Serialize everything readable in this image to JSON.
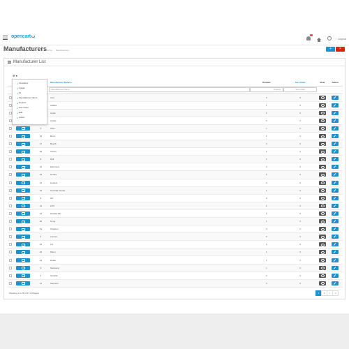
{
  "header": {
    "logo_text": "opencart",
    "logout_label": "Logout"
  },
  "page": {
    "title": "Manufacturers",
    "breadcrumb": [
      "Home",
      "Manufacturers"
    ],
    "add_label": "+",
    "delete_label": "×"
  },
  "panel": {
    "title": "Manufacturer List",
    "column_button": "⚙ ▾"
  },
  "columns_menu": [
    "Checkbox",
    "Image",
    "ID",
    "Manufacturer Name",
    "Product",
    "Sort Order",
    "Edit",
    "Action"
  ],
  "table": {
    "headers": {
      "name": "Manufacturer Name ▴",
      "product": "Product",
      "sort_order": "Sort Order",
      "view": "View",
      "action": "Action"
    },
    "filters": {
      "name_placeholder": "Manufacturer Name",
      "product_placeholder": "Product",
      "sort_placeholder": "Sort Order"
    },
    "rows": [
      {
        "id": "",
        "name": "Acer",
        "product": "0",
        "sort": "0"
      },
      {
        "id": "",
        "name": "Adidas",
        "product": "1",
        "sort": "0"
      },
      {
        "id": "",
        "name": "Apple",
        "product": "1",
        "sort": "0"
      },
      {
        "id": "",
        "name": "Arielle",
        "product": "0",
        "sort": "0"
      },
      {
        "id": "6",
        "name": "Asus",
        "product": "1",
        "sort": "0"
      },
      {
        "id": "15",
        "name": "Benz",
        "product": "1",
        "sort": "0"
      },
      {
        "id": "17",
        "name": "Bosch",
        "product": "0",
        "sort": "0"
      },
      {
        "id": "18",
        "name": "Canon",
        "product": "1",
        "sort": "0"
      },
      {
        "id": "8",
        "name": "Dell",
        "product": "1",
        "sort": "0"
      },
      {
        "id": "10",
        "name": "Electrolux",
        "product": "0",
        "sort": "0"
      },
      {
        "id": "19",
        "name": "Honda",
        "product": "1",
        "sort": "0"
      },
      {
        "id": "14",
        "name": "Huawei",
        "product": "0",
        "sort": "0"
      },
      {
        "id": "16",
        "name": "Hyundai Vendor",
        "product": "1",
        "sort": "0"
      },
      {
        "id": "5",
        "name": "HP",
        "product": "0",
        "sort": "0"
      },
      {
        "id": "13",
        "name": "HTC",
        "product": "1",
        "sort": "0"
      },
      {
        "id": "12",
        "name": "Hewlett Pkr",
        "product": "1",
        "sort": "0"
      },
      {
        "id": "20",
        "name": "Kong",
        "product": "1",
        "sort": "0"
      },
      {
        "id": "19",
        "name": "Kingston",
        "product": "0",
        "sort": "0"
      },
      {
        "id": "3",
        "name": "Lenovo",
        "product": "0",
        "sort": "0"
      },
      {
        "id": "21",
        "name": "LG",
        "product": "1",
        "sort": "0"
      },
      {
        "id": "22",
        "name": "Nikon",
        "product": "1",
        "sort": "0"
      },
      {
        "id": "24",
        "name": "Nokia",
        "product": "1",
        "sort": "0"
      },
      {
        "id": "9",
        "name": "Samsung",
        "product": "1",
        "sort": "0"
      },
      {
        "id": "4",
        "name": "Sandisk",
        "product": "0",
        "sort": "0"
      },
      {
        "id": "11",
        "name": "Siemens",
        "product": "0",
        "sort": "0"
      }
    ]
  },
  "footer": {
    "showing": "Showing 1 to 25 of 27 (2 Pages)",
    "pages": [
      "1",
      "2",
      ">",
      ">|"
    ]
  },
  "colors": {
    "primary": "#1e91cf",
    "danger": "#d9230f"
  }
}
